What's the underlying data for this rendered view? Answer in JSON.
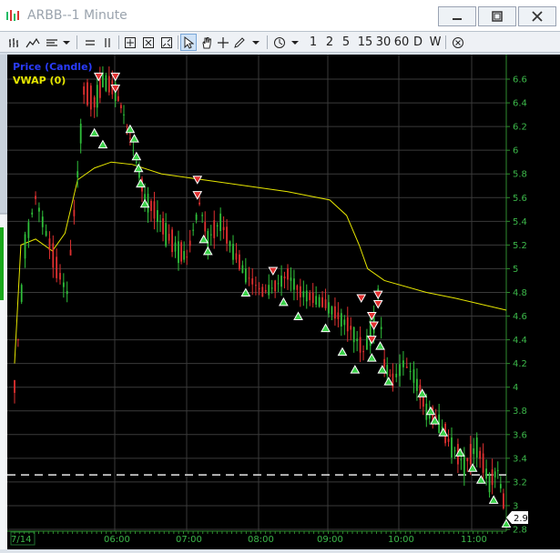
{
  "window": {
    "title": "ARBB--1 Minute",
    "minimize_icon": "minimize-icon",
    "maximize_icon": "maximize-icon",
    "close_icon": "close-icon"
  },
  "toolbar": {
    "tools": [
      "bar-chart-icon",
      "mountain-chart-icon",
      "indicator-icon",
      "dropdown-arrow-icon",
      "horizontal-line-icon",
      "vertical-line-icon",
      "crosshair-icon",
      "zoom-in-icon",
      "zoom-fit-icon",
      "pointer-icon",
      "hand-icon",
      "crosshair-plus-icon",
      "pen-icon",
      "dropdown-arrow-icon",
      "clock-icon",
      "dropdown-arrow-icon",
      "close-circle-icon"
    ],
    "intervals": [
      "1",
      "2",
      "5",
      "15",
      "30",
      "60",
      "D",
      "W"
    ]
  },
  "chart_data": {
    "type": "line",
    "title": "",
    "legend": [
      {
        "name": "Price (Candle)",
        "color": "#2a3cff"
      },
      {
        "name": "VWAP (0)",
        "color": "#e6e600"
      }
    ],
    "x_ticks": [
      "7/14",
      "06:00",
      "07:00",
      "08:00",
      "09:00",
      "10:00",
      "11:00"
    ],
    "y_ticks": [
      "6.6",
      "6.4",
      "6.2",
      "6",
      "5.8",
      "5.6",
      "5.4",
      "5.2",
      "5",
      "4.8",
      "4.6",
      "4.4",
      "4.2",
      "4",
      "3.8",
      "3.6",
      "3.4",
      "3.2",
      "3",
      "2.8"
    ],
    "ylim": [
      2.8,
      6.7
    ],
    "last_price_label": "2.9",
    "reference_level": 3.26,
    "price": [
      [
        0,
        4.0
      ],
      [
        5,
        5.2
      ],
      [
        10,
        5.6
      ],
      [
        15,
        5.3
      ],
      [
        20,
        5.0
      ],
      [
        25,
        4.8
      ],
      [
        30,
        5.8
      ],
      [
        33,
        6.5
      ],
      [
        38,
        6.4
      ],
      [
        42,
        6.6
      ],
      [
        48,
        6.5
      ],
      [
        52,
        6.3
      ],
      [
        55,
        6.1
      ],
      [
        58,
        5.9
      ],
      [
        62,
        5.6
      ],
      [
        68,
        5.45
      ],
      [
        72,
        5.3
      ],
      [
        78,
        5.15
      ],
      [
        82,
        5.1
      ],
      [
        88,
        5.55
      ],
      [
        92,
        5.25
      ],
      [
        98,
        5.4
      ],
      [
        104,
        5.15
      ],
      [
        110,
        4.95
      ],
      [
        118,
        4.8
      ],
      [
        124,
        4.85
      ],
      [
        130,
        4.95
      ],
      [
        136,
        4.8
      ],
      [
        142,
        4.75
      ],
      [
        148,
        4.7
      ],
      [
        154,
        4.6
      ],
      [
        160,
        4.5
      ],
      [
        166,
        4.3
      ],
      [
        171,
        4.55
      ],
      [
        173,
        4.8
      ],
      [
        176,
        4.2
      ],
      [
        180,
        4.05
      ],
      [
        185,
        4.2
      ],
      [
        190,
        4.1
      ],
      [
        196,
        3.8
      ],
      [
        202,
        3.7
      ],
      [
        208,
        3.5
      ],
      [
        214,
        3.35
      ],
      [
        220,
        3.5
      ],
      [
        226,
        3.2
      ],
      [
        230,
        3.3
      ],
      [
        234,
        2.9
      ]
    ],
    "vwap": [
      [
        0,
        4.2
      ],
      [
        3,
        5.2
      ],
      [
        10,
        5.25
      ],
      [
        18,
        5.15
      ],
      [
        24,
        5.3
      ],
      [
        30,
        5.75
      ],
      [
        38,
        5.85
      ],
      [
        46,
        5.9
      ],
      [
        56,
        5.88
      ],
      [
        70,
        5.8
      ],
      [
        90,
        5.75
      ],
      [
        110,
        5.7
      ],
      [
        130,
        5.65
      ],
      [
        150,
        5.58
      ],
      [
        158,
        5.45
      ],
      [
        164,
        5.2
      ],
      [
        168,
        5.0
      ],
      [
        176,
        4.9
      ],
      [
        196,
        4.8
      ],
      [
        210,
        4.75
      ],
      [
        222,
        4.7
      ],
      [
        234,
        4.65
      ]
    ],
    "sell_signals": [
      [
        40,
        6.62
      ],
      [
        48,
        6.62
      ],
      [
        48,
        6.52
      ],
      [
        87,
        5.75
      ],
      [
        87,
        5.62
      ],
      [
        123,
        4.98
      ],
      [
        165,
        4.75
      ],
      [
        170,
        4.6
      ],
      [
        171,
        4.52
      ],
      [
        173,
        4.7
      ],
      [
        173,
        4.78
      ],
      [
        170,
        4.4
      ]
    ],
    "buy_signals": [
      [
        38,
        6.15
      ],
      [
        42,
        6.05
      ],
      [
        55,
        6.18
      ],
      [
        57,
        6.1
      ],
      [
        58,
        5.95
      ],
      [
        59,
        5.85
      ],
      [
        60,
        5.72
      ],
      [
        62,
        5.55
      ],
      [
        90,
        5.25
      ],
      [
        92,
        5.15
      ],
      [
        110,
        4.8
      ],
      [
        128,
        4.72
      ],
      [
        135,
        4.6
      ],
      [
        148,
        4.5
      ],
      [
        156,
        4.3
      ],
      [
        162,
        4.15
      ],
      [
        170,
        4.25
      ],
      [
        174,
        4.35
      ],
      [
        175,
        4.15
      ],
      [
        178,
        4.05
      ],
      [
        194,
        3.95
      ],
      [
        198,
        3.8
      ],
      [
        200,
        3.72
      ],
      [
        204,
        3.62
      ],
      [
        212,
        3.45
      ],
      [
        218,
        3.32
      ],
      [
        222,
        3.22
      ],
      [
        228,
        3.05
      ],
      [
        234,
        2.85
      ]
    ]
  }
}
